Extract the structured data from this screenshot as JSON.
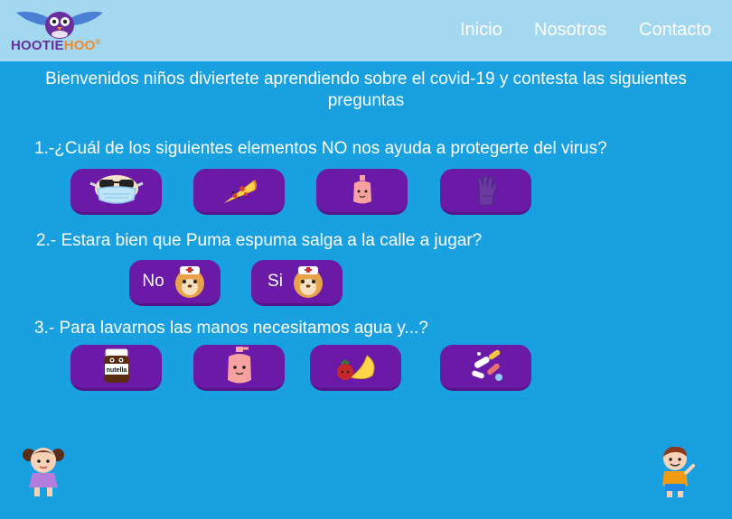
{
  "brand": {
    "name_part1": "HOOTIE",
    "name_part2": "HOO",
    "reg": "®"
  },
  "nav": {
    "items": [
      "Inicio",
      "Nosotros",
      "Contacto"
    ]
  },
  "intro": {
    "text": "Bienvenidos niños diviertete aprendiendo sobre el covid-19 y contesta las siguientes preguntas"
  },
  "questions": [
    {
      "text": "1.-¿Cuál de los siguientes elementos NO nos ayuda a protegerte del virus?",
      "options": [
        {
          "icon": "face-mask-icon"
        },
        {
          "icon": "pizza-icon"
        },
        {
          "icon": "soap-bottle-icon"
        },
        {
          "icon": "glove-icon"
        }
      ]
    },
    {
      "text": "2.- Estara bien que Puma espuma salga a la calle a jugar?",
      "options": [
        {
          "label": "No",
          "icon": "puma-nurse-icon"
        },
        {
          "label": "Si",
          "icon": "puma-nurse-icon"
        }
      ]
    },
    {
      "text": "3.- Para lavarnos las manos necesitamos agua y...?",
      "options": [
        {
          "icon": "nutella-jar-icon",
          "icon_text": "nutella"
        },
        {
          "icon": "soap-bottle-icon"
        },
        {
          "icon": "fruits-icon"
        },
        {
          "icon": "pills-icon"
        }
      ]
    }
  ],
  "colors": {
    "background": "#19a0e0",
    "header": "#a4d8f0",
    "option_button": "#6b1aa8",
    "brand_purple": "#6a2f9e",
    "brand_orange": "#f28a2b"
  }
}
